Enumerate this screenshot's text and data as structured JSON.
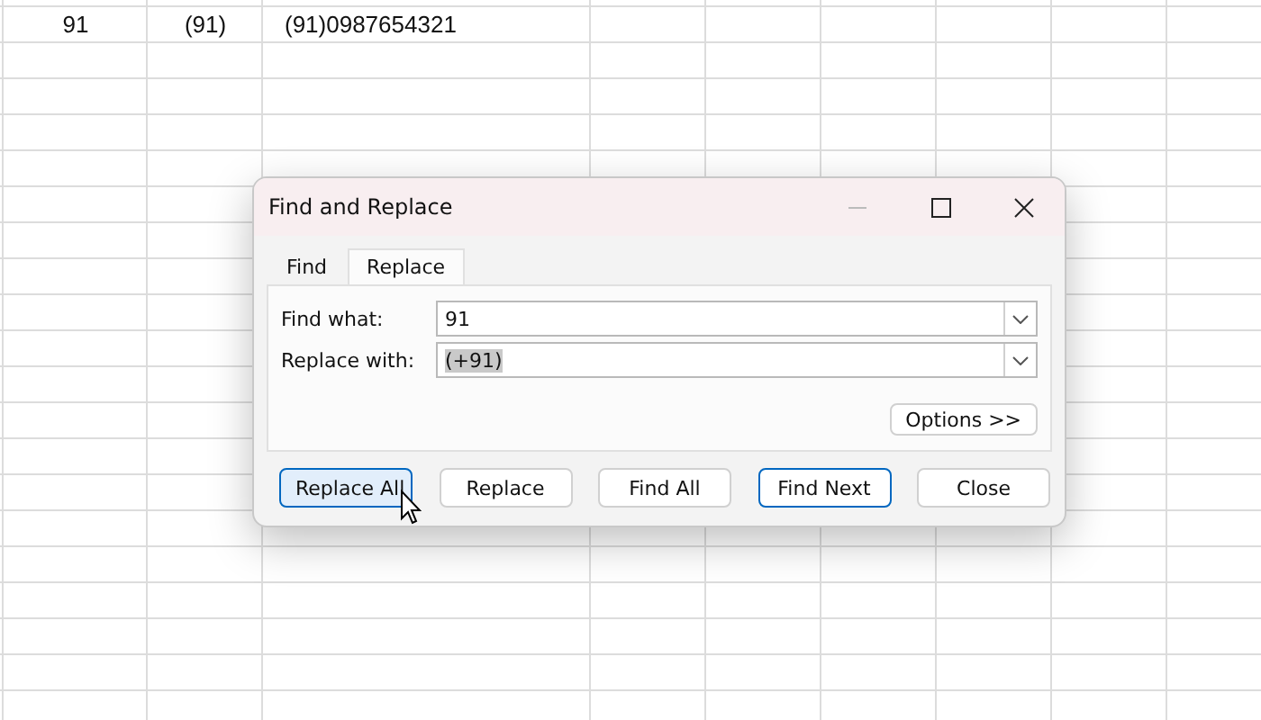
{
  "sheet": {
    "rows": [
      [
        "91",
        "(91)",
        "(91)0987654321"
      ]
    ]
  },
  "dialog": {
    "title": "Find and Replace",
    "tabs": [
      {
        "label": "Find",
        "selected": false
      },
      {
        "label": "Replace",
        "selected": true
      }
    ],
    "fields": [
      {
        "label": "Find what:",
        "value": "91",
        "highlighted": false
      },
      {
        "label": "Replace with:",
        "value": "(+91)",
        "highlighted": true
      }
    ],
    "options_button": {
      "label": "Options >>"
    },
    "buttons": [
      {
        "label": "Replace All",
        "hovered": true,
        "default": false
      },
      {
        "label": "Replace",
        "hovered": false,
        "default": false
      },
      {
        "label": "Find All",
        "hovered": false,
        "default": false
      },
      {
        "label": "Find Next",
        "hovered": false,
        "default": true
      },
      {
        "label": "Close",
        "hovered": false,
        "default": false
      }
    ]
  }
}
